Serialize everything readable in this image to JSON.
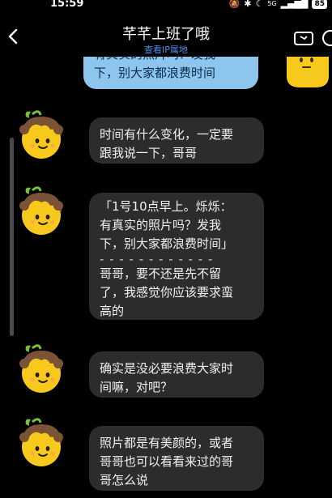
{
  "status_bar": {
    "time": "15:59",
    "icons": [
      "notification-mute-icon",
      "bluetooth-icon",
      "moon-icon",
      "wifi-icon",
      "signal-icon"
    ],
    "network_label": "5G",
    "battery": "85"
  },
  "header": {
    "title": "芊芊上班了哦",
    "subtitle": "查看IP属地"
  },
  "messages": [
    {
      "sender": "self",
      "lines": [
        "有真实的照片吗？发我",
        "下，别大家都浪费时间"
      ]
    },
    {
      "sender": "other",
      "lines": [
        "时间有什么变化，一定要",
        "跟我说一下，哥哥"
      ]
    },
    {
      "sender": "other",
      "quote_lines": [
        "「1号10点早上。烁烁：",
        "有真实的照片吗？发我",
        "下，别大家都浪费时间」"
      ],
      "divider": "- - - - - - - - - - - -",
      "lines": [
        "哥哥，要不还是先不留",
        "了，我感觉你应该要求蛮",
        "高的"
      ]
    },
    {
      "sender": "other",
      "lines": [
        "确实是没必要浪费大家时",
        "间嘛，对吧？"
      ]
    },
    {
      "sender": "other",
      "lines": [
        "照片都是有美颜的，或者",
        "哥哥也可以看看来过的哥",
        "哥怎么说"
      ]
    }
  ],
  "colors": {
    "background": "#000000",
    "incoming_bubble": "#2c2c2e",
    "outgoing_bubble": "#8ec5ef",
    "link": "#4c8fe8",
    "avatar_face": "#f7c91d",
    "avatar_hair": "#7a5236"
  }
}
